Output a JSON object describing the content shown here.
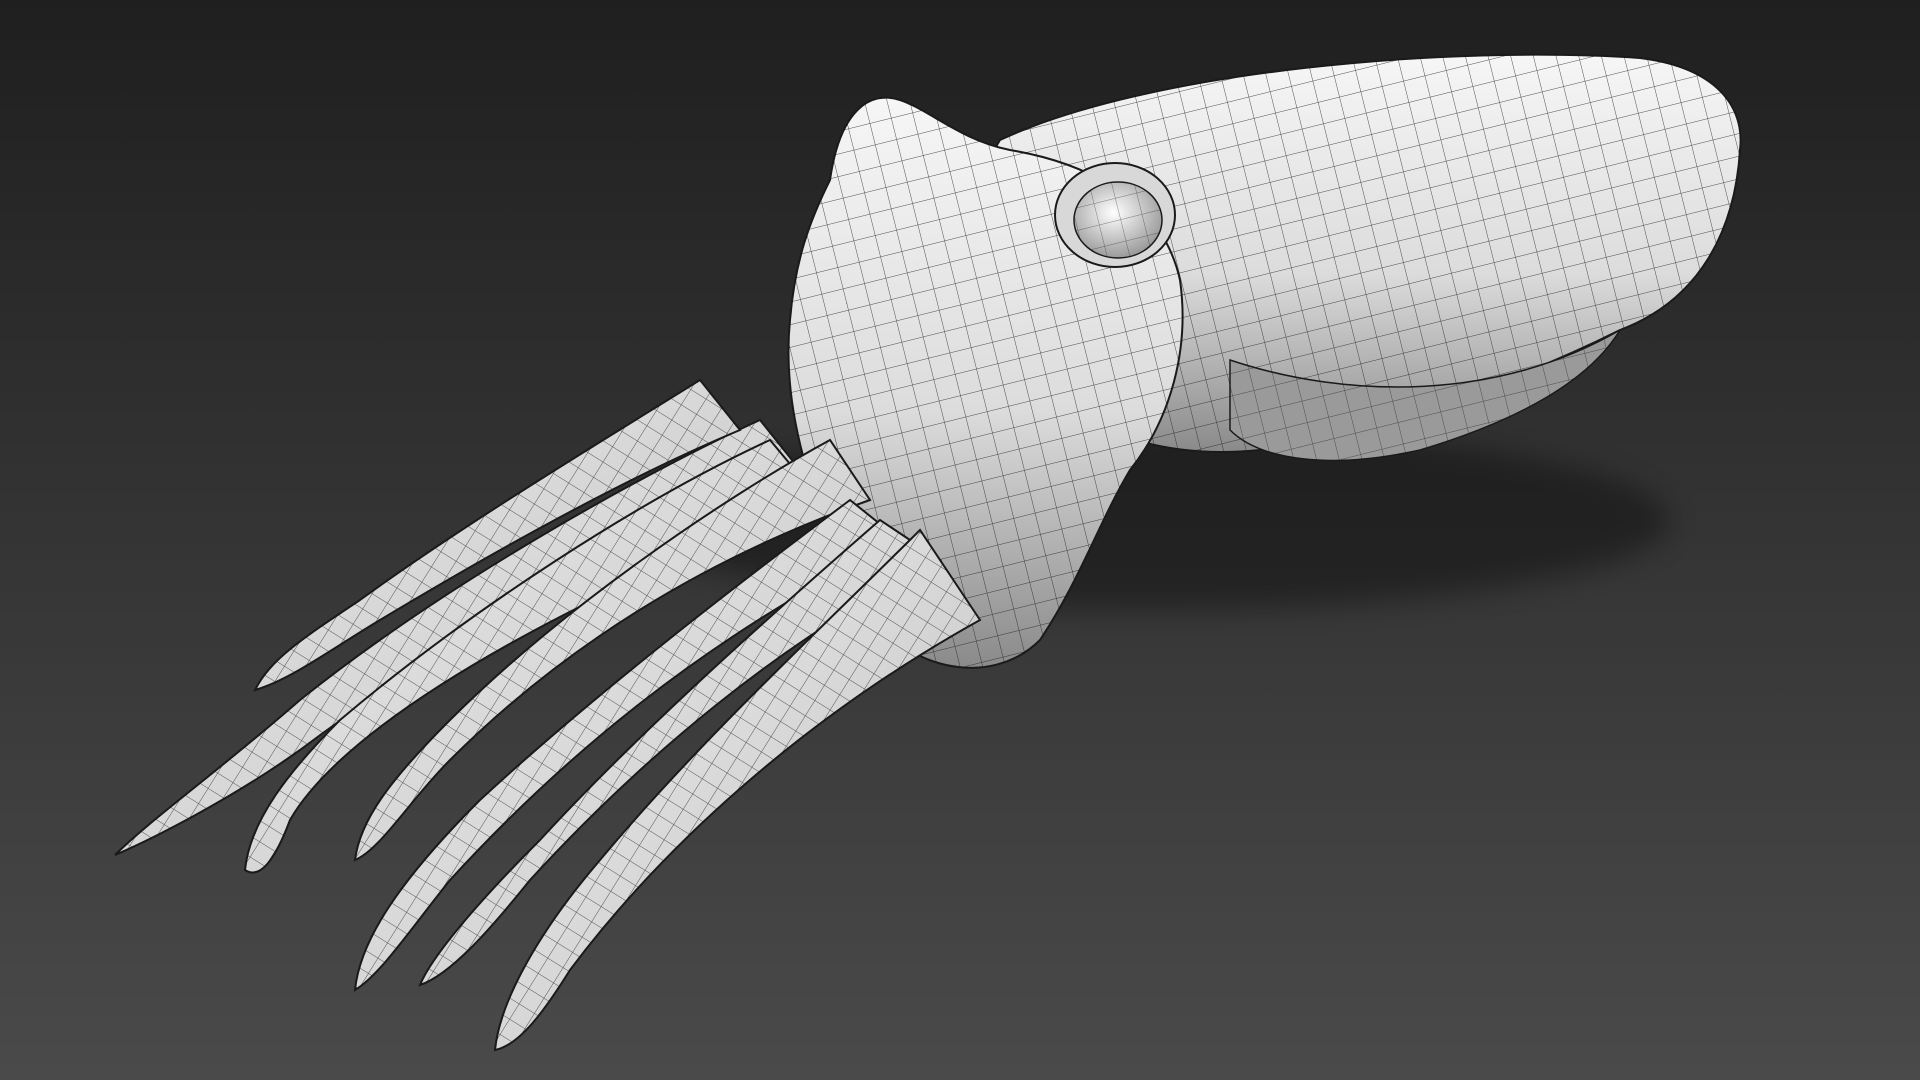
{
  "viewport": {
    "background_top": "#1f1f1f",
    "background_bottom": "#4a4a4a"
  },
  "model": {
    "name": "cuttlefish-wireframe-model",
    "surface_light": "#f4f4f4",
    "surface_mid": "#c9c9c9",
    "surface_shadow": "#7a7a7a",
    "wire_color": "#1a1a1a"
  }
}
